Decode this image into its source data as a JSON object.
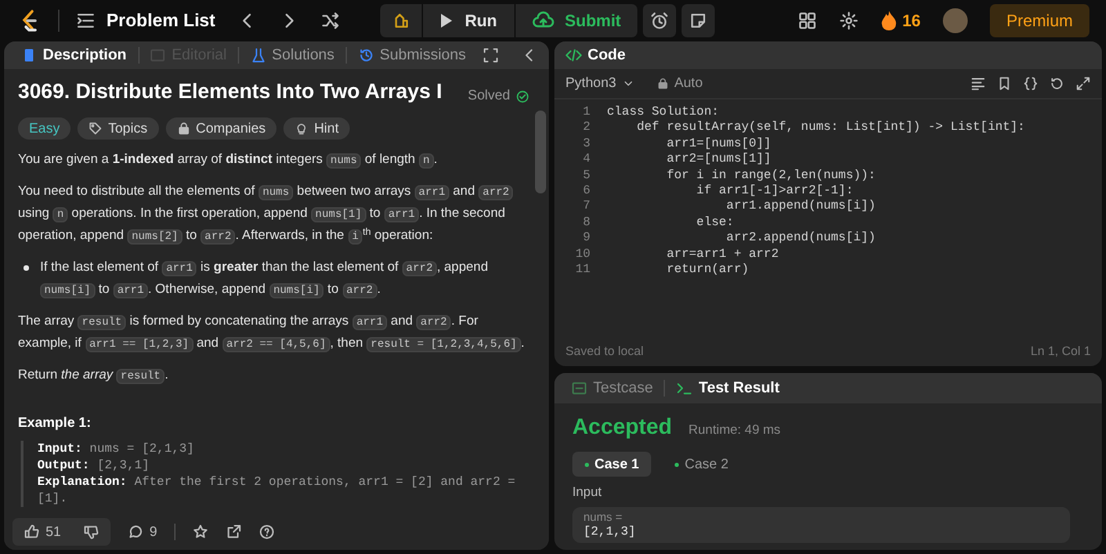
{
  "top_bar": {
    "problem_list": "Problem List",
    "run": "Run",
    "submit": "Submit",
    "streak": "16",
    "premium": "Premium"
  },
  "description_panel": {
    "tabs": [
      {
        "label": "Description",
        "selected": true,
        "disabled": false
      },
      {
        "label": "Editorial",
        "selected": false,
        "disabled": true
      },
      {
        "label": "Solutions",
        "selected": false,
        "disabled": false
      },
      {
        "label": "Submissions",
        "selected": false,
        "disabled": false
      }
    ],
    "title": "3069. Distribute Elements Into Two Arrays I",
    "status": "Solved",
    "tags": [
      {
        "label": "Easy",
        "kind": "difficulty"
      },
      {
        "label": "Topics",
        "kind": "topics"
      },
      {
        "label": "Companies",
        "kind": "companies"
      },
      {
        "label": "Hint",
        "kind": "hint"
      }
    ],
    "paragraphs": [
      {
        "kind": "paragraph",
        "segments": [
          {
            "kind": "text",
            "text": "You are given a **1-indexed** array of **distinct** integers "
          },
          {
            "kind": "code",
            "text": "nums"
          },
          {
            "kind": "text",
            "text": " of length "
          },
          {
            "kind": "code",
            "text": "n"
          },
          {
            "kind": "text",
            "text": "."
          }
        ]
      },
      {
        "kind": "paragraph",
        "segments": [
          {
            "kind": "text",
            "text": "You need to distribute all the elements of "
          },
          {
            "kind": "code",
            "text": "nums"
          },
          {
            "kind": "text",
            "text": " between two arrays "
          },
          {
            "kind": "code",
            "text": "arr1"
          },
          {
            "kind": "text",
            "text": " and "
          },
          {
            "kind": "code",
            "text": "arr2"
          },
          {
            "kind": "text",
            "text": " using "
          },
          {
            "kind": "code",
            "text": "n"
          },
          {
            "kind": "text",
            "text": " operations. In the first operation, append "
          },
          {
            "kind": "code",
            "text": "nums[1]"
          },
          {
            "kind": "text",
            "text": " to "
          },
          {
            "kind": "code",
            "text": "arr1"
          },
          {
            "kind": "text",
            "text": ". In the second operation, append "
          },
          {
            "kind": "code",
            "text": "nums[2]"
          },
          {
            "kind": "text",
            "text": " to "
          },
          {
            "kind": "code",
            "text": "arr2"
          },
          {
            "kind": "text",
            "text": ". Afterwards, in the "
          },
          {
            "kind": "code",
            "text": "i"
          },
          {
            "kind": "text",
            "text": "$^{th}$ operation:"
          }
        ]
      },
      {
        "kind": "bullet",
        "segments": [
          {
            "kind": "text",
            "text": "If the last element of "
          },
          {
            "kind": "code",
            "text": "arr1"
          },
          {
            "kind": "text",
            "text": " is **greater** than the last element of "
          },
          {
            "kind": "code",
            "text": "arr2"
          },
          {
            "kind": "text",
            "text": ", append "
          },
          {
            "kind": "code",
            "text": "nums[i]"
          },
          {
            "kind": "text",
            "text": " to "
          },
          {
            "kind": "code",
            "text": "arr1"
          },
          {
            "kind": "text",
            "text": ". Otherwise, append "
          },
          {
            "kind": "code",
            "text": "nums[i]"
          },
          {
            "kind": "text",
            "text": " to "
          },
          {
            "kind": "code",
            "text": "arr2"
          },
          {
            "kind": "text",
            "text": "."
          }
        ]
      },
      {
        "kind": "paragraph",
        "segments": [
          {
            "kind": "text",
            "text": "The array "
          },
          {
            "kind": "code",
            "text": "result"
          },
          {
            "kind": "text",
            "text": " is formed by concatenating the arrays "
          },
          {
            "kind": "code",
            "text": "arr1"
          },
          {
            "kind": "text",
            "text": " and "
          },
          {
            "kind": "code",
            "text": "arr2"
          },
          {
            "kind": "text",
            "text": ". For example, if "
          },
          {
            "kind": "code",
            "text": "arr1 == [1,2,3]"
          },
          {
            "kind": "text",
            "text": " and "
          },
          {
            "kind": "code",
            "text": "arr2 == [4,5,6]"
          },
          {
            "kind": "text",
            "text": ", then "
          },
          {
            "kind": "code",
            "text": "result = [1,2,3,4,5,6]"
          },
          {
            "kind": "text",
            "text": "."
          }
        ]
      },
      {
        "kind": "paragraph",
        "segments": [
          {
            "kind": "text",
            "text": "Return *the array* "
          },
          {
            "kind": "code",
            "text": "result"
          },
          {
            "kind": "text",
            "text": "."
          }
        ]
      }
    ],
    "example": {
      "heading": "Example 1:",
      "lines": [
        {
          "label": "Input:",
          "value": "nums = [2,1,3]"
        },
        {
          "label": "Output:",
          "value": "[2,3,1]"
        },
        {
          "label": "Explanation:",
          "value": "After the first 2 operations, arr1 = [2] and arr2 = [1]."
        }
      ]
    },
    "footer": {
      "likes": "51",
      "comments": "9"
    }
  },
  "code_panel": {
    "title": "Code",
    "language": "Python3",
    "mode": "Auto",
    "lines": [
      {
        "number": "1",
        "text": "class Solution:"
      },
      {
        "number": "2",
        "text": "    def resultArray(self, nums: List[int]) -> List[int]:"
      },
      {
        "number": "3",
        "text": "        arr1=[nums[0]]"
      },
      {
        "number": "4",
        "text": "        arr2=[nums[1]]"
      },
      {
        "number": "5",
        "text": "        for i in range(2,len(nums)):"
      },
      {
        "number": "6",
        "text": "            if arr1[-1]>arr2[-1]:"
      },
      {
        "number": "7",
        "text": "                arr1.append(nums[i])"
      },
      {
        "number": "8",
        "text": "            else:"
      },
      {
        "number": "9",
        "text": "                arr2.append(nums[i])"
      },
      {
        "number": "10",
        "text": "        arr=arr1 + arr2"
      },
      {
        "number": "11",
        "text": "        return(arr)"
      }
    ],
    "status": "Saved to local",
    "cursor": "Ln 1, Col 1"
  },
  "result_panel": {
    "tabs": [
      {
        "label": "Testcase",
        "selected": false
      },
      {
        "label": "Test Result",
        "selected": true
      }
    ],
    "verdict": "Accepted",
    "runtime": "Runtime: 49 ms",
    "cases": [
      {
        "label": "Case 1",
        "selected": true
      },
      {
        "label": "Case 2",
        "selected": false
      }
    ],
    "input_label": "Input",
    "variable": "nums =",
    "value": "[2,1,3]"
  }
}
